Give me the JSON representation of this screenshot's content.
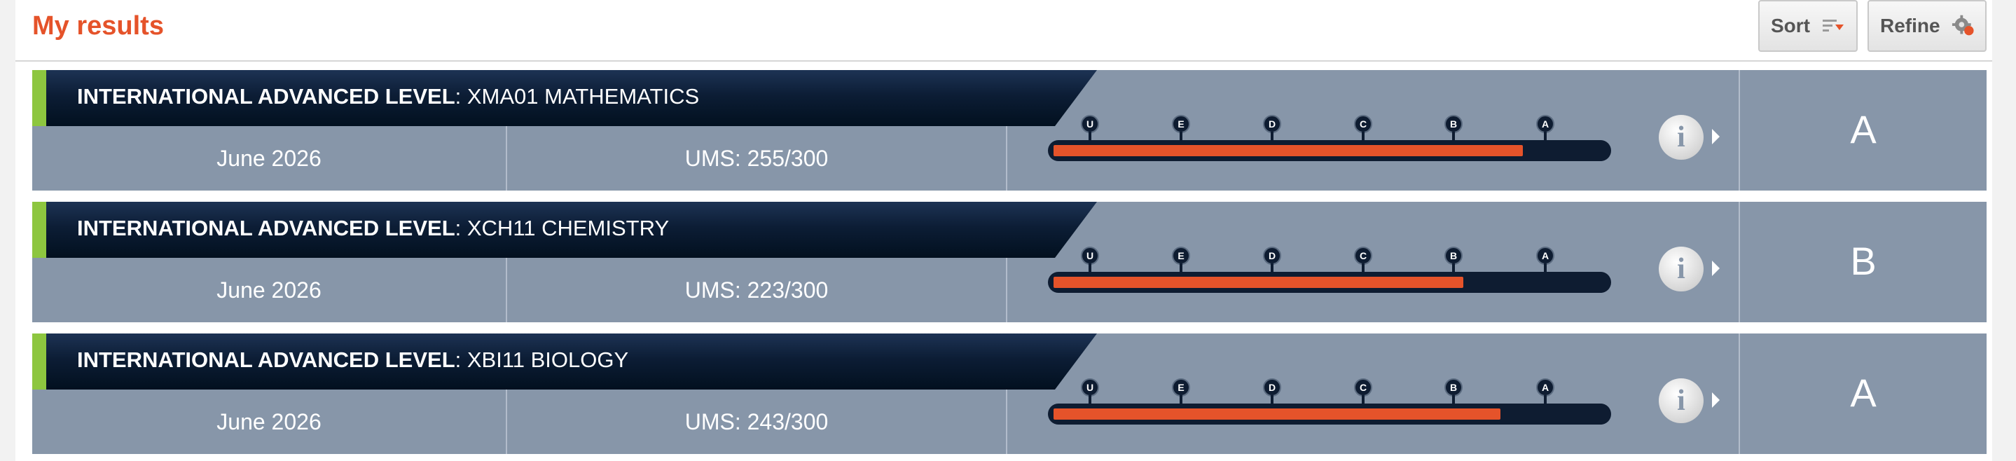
{
  "page": {
    "title": "My results",
    "sort_label": "Sort",
    "refine_label": "Refine"
  },
  "grade_scale": [
    "U",
    "E",
    "D",
    "C",
    "B",
    "A"
  ],
  "results": [
    {
      "qualification": "INTERNATIONAL ADVANCED LEVEL",
      "subject": ": XMA01 MATHEMATICS",
      "session": "June 2026",
      "ums": "UMS: 255/300",
      "ums_fraction": 0.85,
      "grade": "A"
    },
    {
      "qualification": "INTERNATIONAL ADVANCED LEVEL",
      "subject": ": XCH11 CHEMISTRY",
      "session": "June 2026",
      "ums": "UMS: 223/300",
      "ums_fraction": 0.743,
      "grade": "B"
    },
    {
      "qualification": "INTERNATIONAL ADVANCED LEVEL",
      "subject": ": XBI11 BIOLOGY",
      "session": "June 2026",
      "ums": "UMS: 243/300",
      "ums_fraction": 0.81,
      "grade": "A"
    }
  ],
  "colors": {
    "accent_orange": "#e5532a",
    "row_background": "#8796a9",
    "banner_navy": "#0c1d35",
    "accent_green": "#8dc63f"
  },
  "icons": {
    "sort": "sort-lines-icon",
    "refine": "refine-cog-icon",
    "info": "info-icon"
  }
}
